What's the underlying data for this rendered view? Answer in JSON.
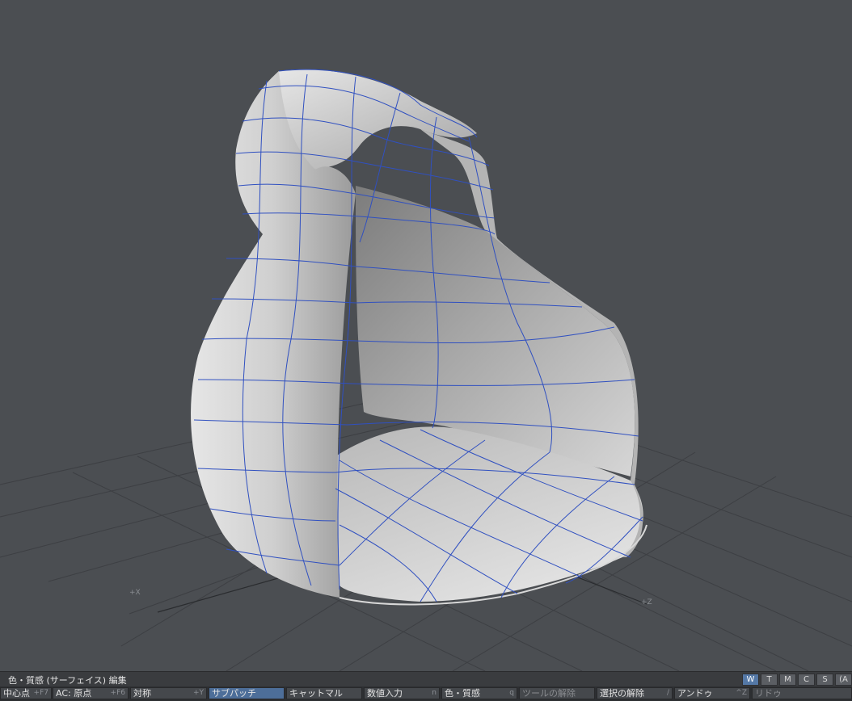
{
  "viewport": {
    "axes": {
      "x_label": "+X",
      "z_label": "+Z"
    },
    "colors": {
      "background": "#4b4e52",
      "grid": "#3c3e41",
      "surface": "#bdbdbd",
      "cage": "#2f48b8"
    }
  },
  "statusbar": {
    "text": "色・質感 (サーフェイス) 編集",
    "mode_buttons": [
      {
        "label": "W",
        "active": true
      },
      {
        "label": "T",
        "active": false
      },
      {
        "label": "M",
        "active": false
      },
      {
        "label": "C",
        "active": false
      },
      {
        "label": "S",
        "active": false
      },
      {
        "label": "(A",
        "active": false
      }
    ]
  },
  "toolbar": {
    "buttons": [
      {
        "label": "中心点",
        "shortcut": "+F7"
      },
      {
        "label": "AC: 原点",
        "shortcut": "+F6"
      },
      {
        "label": "対称",
        "shortcut": "+Y"
      },
      {
        "label": "サブパッチ",
        "shortcut": "",
        "active": true
      },
      {
        "label": "キャットマル",
        "shortcut": ""
      },
      {
        "label": "数値入力",
        "shortcut": "n"
      },
      {
        "label": "色・質感",
        "shortcut": "q"
      },
      {
        "label": "ツールの解除",
        "shortcut": "",
        "dim": true
      },
      {
        "label": "選択の解除",
        "shortcut": "/"
      },
      {
        "label": "アンドゥ",
        "shortcut": "^Z"
      },
      {
        "label": "リドゥ",
        "shortcut": "",
        "dim": true
      }
    ]
  }
}
